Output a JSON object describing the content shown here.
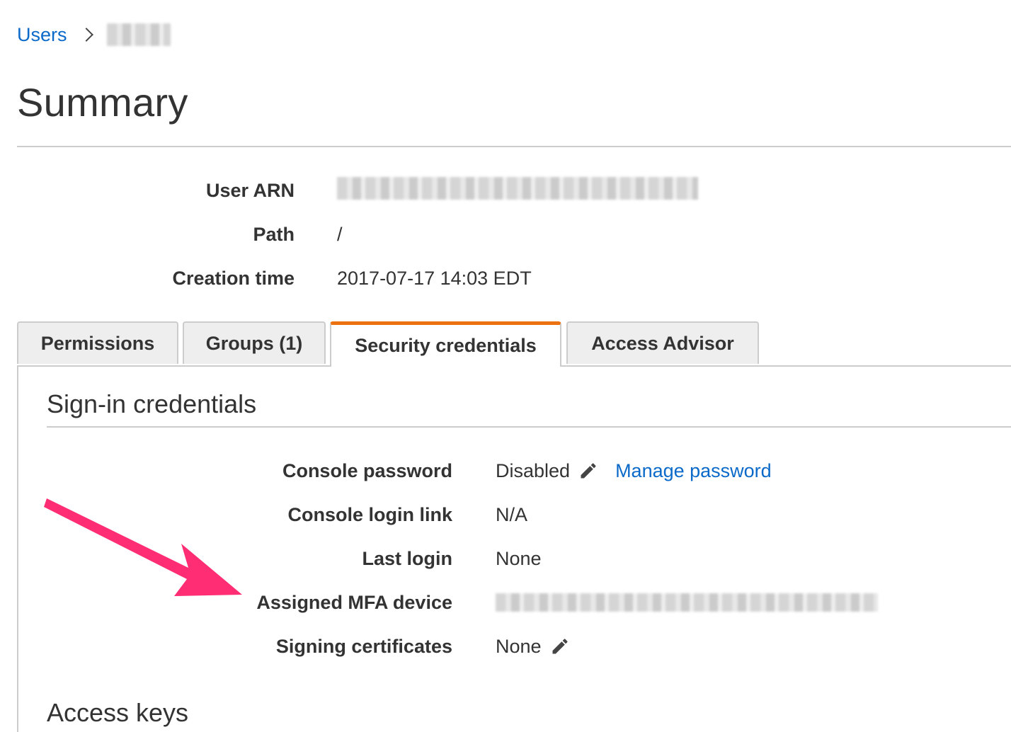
{
  "breadcrumb": {
    "root_label": "Users"
  },
  "page": {
    "title": "Summary"
  },
  "summary": {
    "user_arn_label": "User ARN",
    "path_label": "Path",
    "path_value": "/",
    "creation_time_label": "Creation time",
    "creation_time_value": "2017-07-17 14:03 EDT"
  },
  "tabs": [
    {
      "label": "Permissions",
      "active": false
    },
    {
      "label": "Groups (1)",
      "active": false
    },
    {
      "label": "Security credentials",
      "active": true
    },
    {
      "label": "Access Advisor",
      "active": false
    }
  ],
  "signin": {
    "title": "Sign-in credentials",
    "rows": {
      "console_password": {
        "label": "Console password",
        "value": "Disabled",
        "link": "Manage password"
      },
      "console_login_link": {
        "label": "Console login link",
        "value": "N/A"
      },
      "last_login": {
        "label": "Last login",
        "value": "None"
      },
      "mfa_device": {
        "label": "Assigned MFA device"
      },
      "signing_certificates": {
        "label": "Signing certificates",
        "value": "None"
      }
    }
  },
  "access_keys": {
    "title": "Access keys"
  },
  "colors": {
    "link": "#0b6ac9",
    "active_tab_accent": "#ec7211",
    "annotation_arrow": "#ff2d73",
    "rule": "#cccccc"
  },
  "icons": {
    "breadcrumb_separator": "chevron-right-icon",
    "edit": "pencil-icon"
  }
}
